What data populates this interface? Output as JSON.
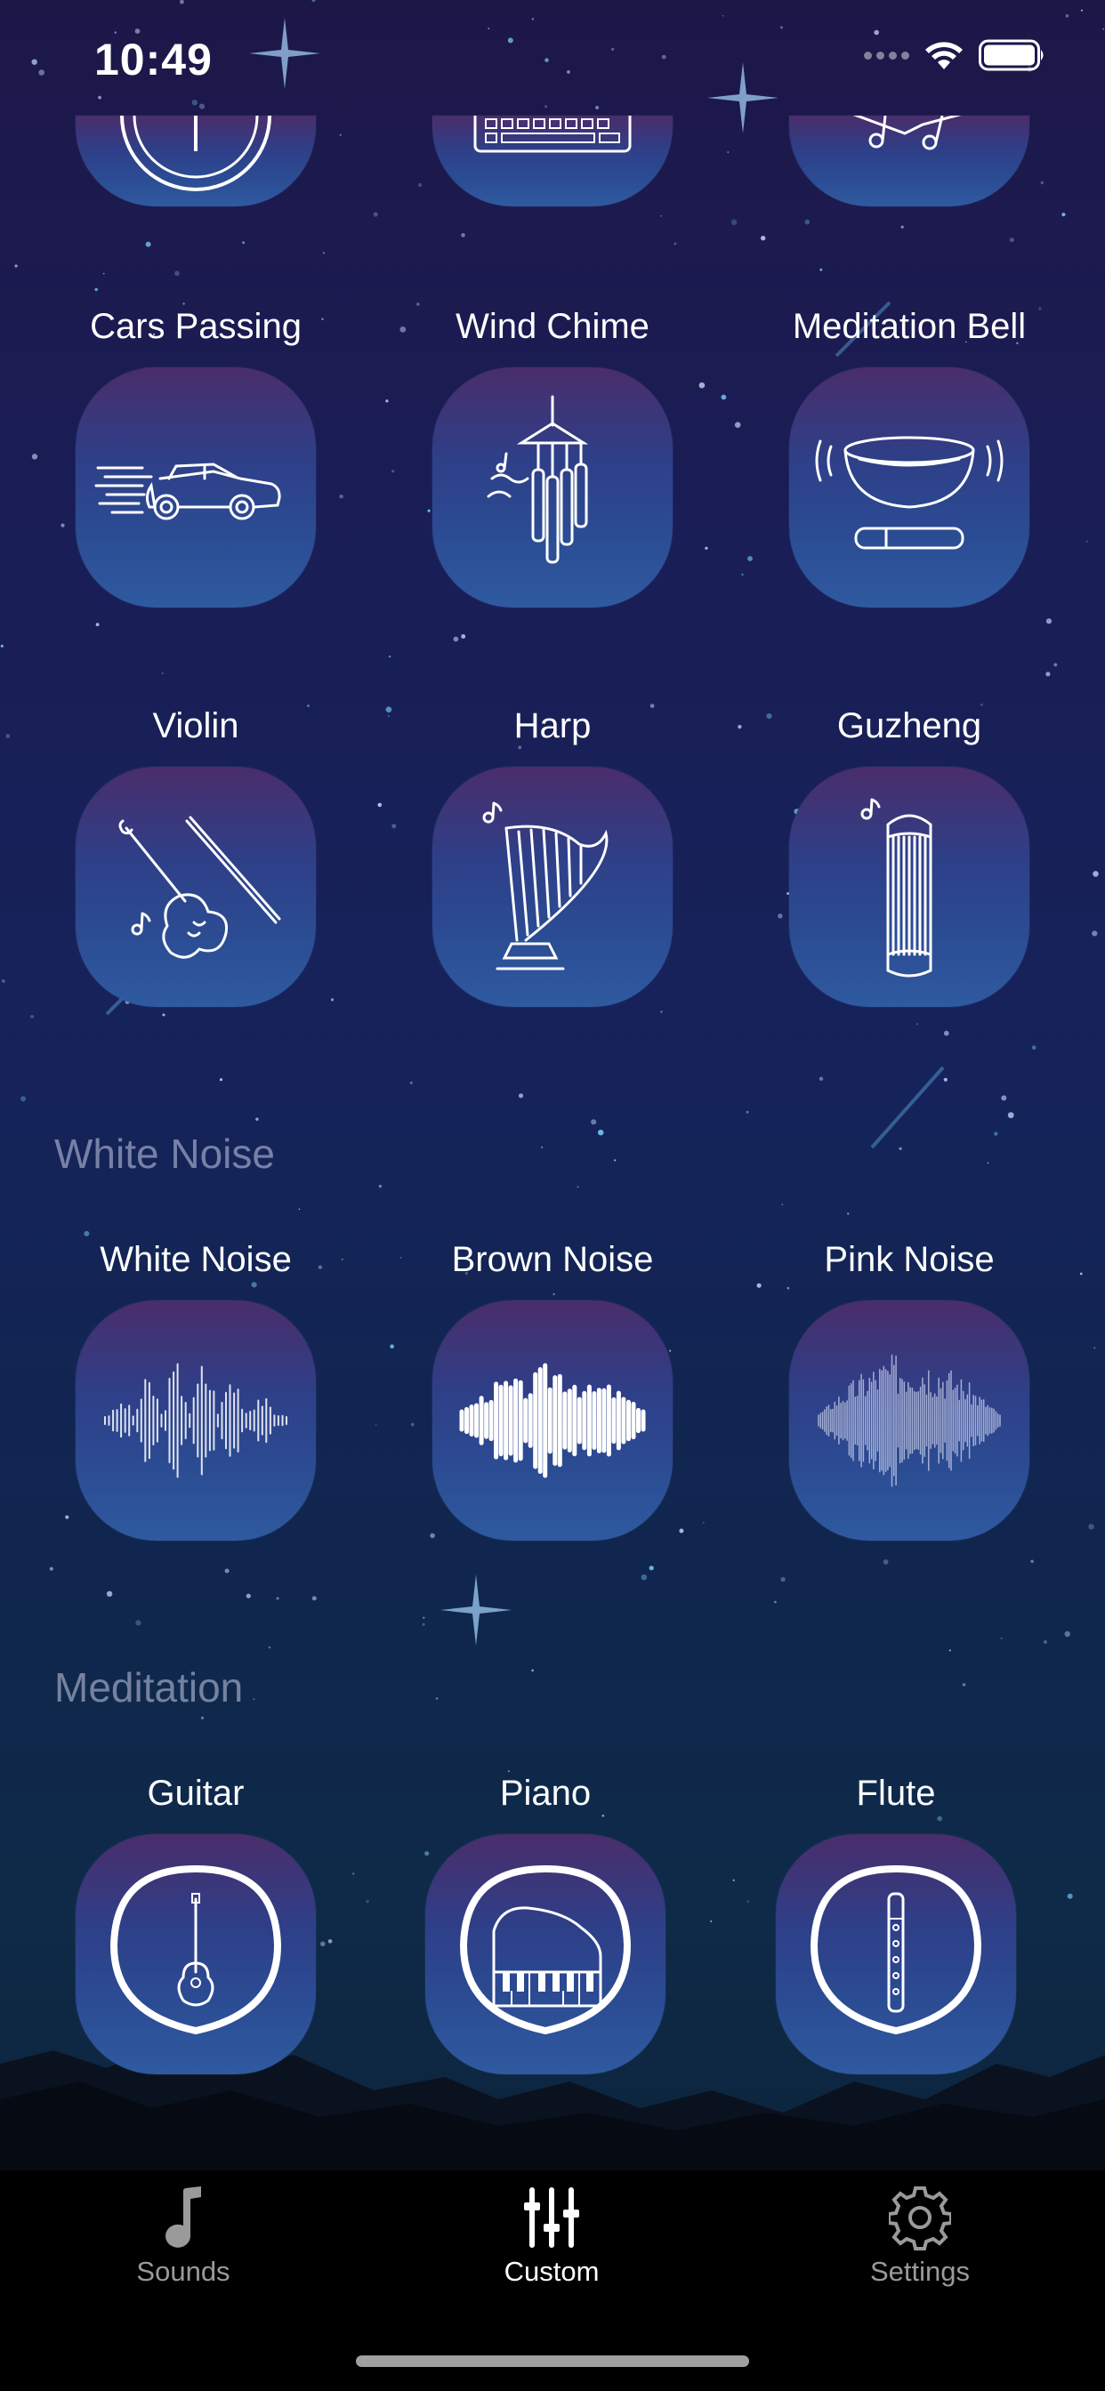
{
  "status_bar": {
    "time": "10:49"
  },
  "sections": {
    "white_noise_title": "White Noise",
    "meditation_title": "Meditation"
  },
  "sounds": {
    "cars_passing": "Cars Passing",
    "wind_chime": "Wind Chime",
    "meditation_bell": "Meditation Bell",
    "violin": "Violin",
    "harp": "Harp",
    "guzheng": "Guzheng",
    "white_noise": "White Noise",
    "brown_noise": "Brown Noise",
    "pink_noise": "Pink Noise",
    "guitar": "Guitar",
    "piano": "Piano",
    "flute": "Flute"
  },
  "tab_bar": {
    "sounds": "Sounds",
    "custom": "Custom",
    "settings": "Settings",
    "active": "custom"
  },
  "colors": {
    "tile_top": "#4a2d6b",
    "tile_bottom": "#2f5aa0",
    "active_tab": "#ffffff",
    "inactive_tab": "#9a9a9a"
  },
  "icons": {
    "cars_passing": "car-icon",
    "wind_chime": "wind-chime-icon",
    "meditation_bell": "singing-bowl-icon",
    "violin": "violin-icon",
    "harp": "harp-icon",
    "guzheng": "guzheng-icon",
    "white_noise": "waveform-icon",
    "brown_noise": "waveform-icon",
    "pink_noise": "waveform-icon",
    "guitar": "guitar-icon",
    "piano": "piano-icon",
    "flute": "flute-icon"
  }
}
